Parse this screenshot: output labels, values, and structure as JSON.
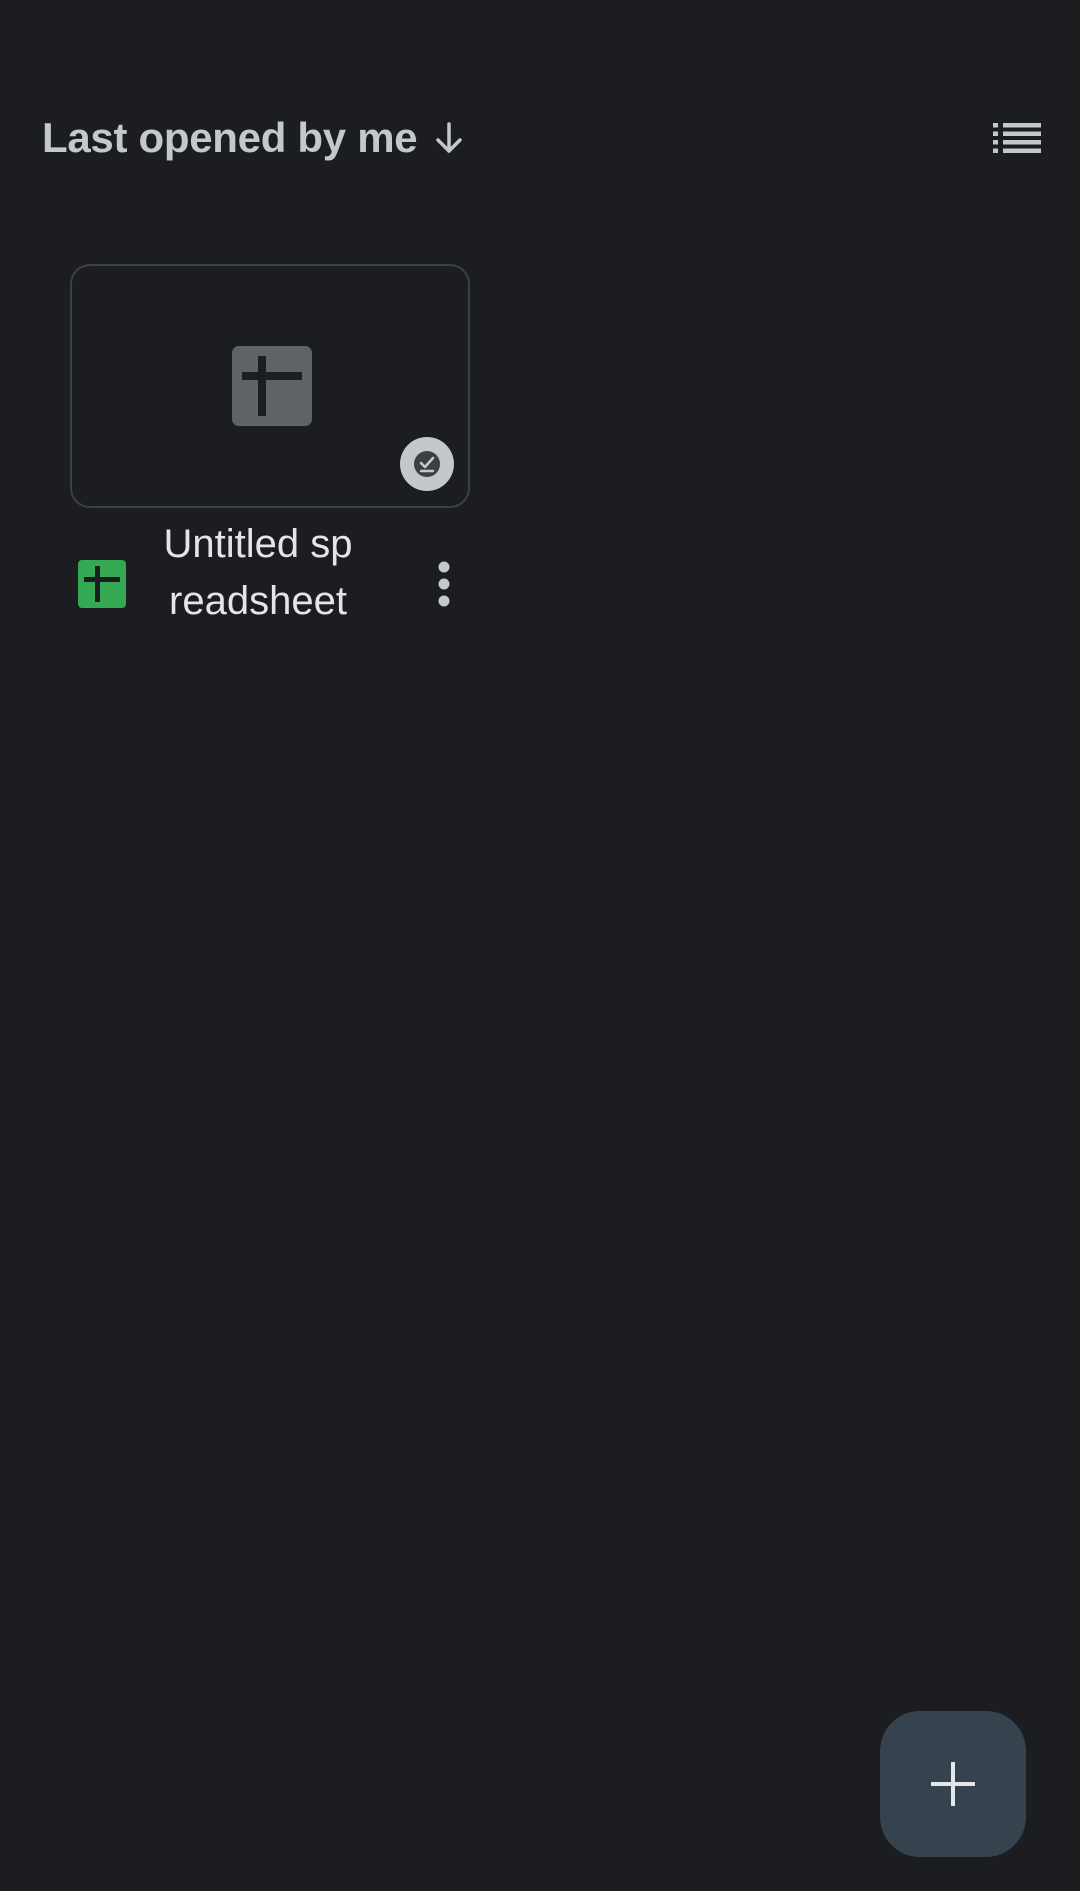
{
  "sort": {
    "label": "Last opened by me",
    "direction_icon": "arrow-down-icon"
  },
  "view_toggle": {
    "icon": "list-view-icon"
  },
  "files": [
    {
      "name": "Untitled spreadsheet",
      "type_icon": "sheets-icon",
      "thumbnail_icon": "sheets-placeholder-icon",
      "offline_icon": "offline-available-icon",
      "more_icon": "more-vert-icon"
    }
  ],
  "fab": {
    "icon": "plus-icon"
  },
  "colors": {
    "background": "#1b1d20",
    "text_primary": "#e3e5e8",
    "text_secondary": "#c4c7cc",
    "sheets_green": "#34a853",
    "fab_background": "#36434f",
    "card_border": "#3d4045"
  }
}
